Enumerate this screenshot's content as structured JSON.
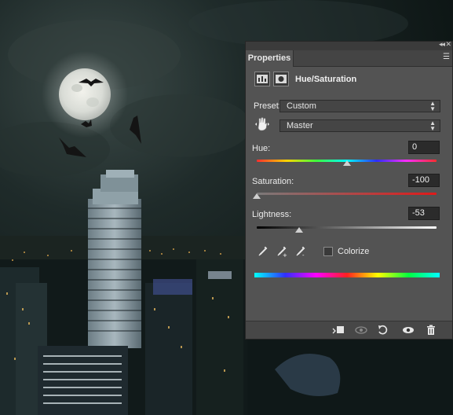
{
  "panel": {
    "tab_label": "Properties",
    "title": "Hue/Saturation",
    "preset_label": "Preset:",
    "preset_value": "Custom",
    "channel_value": "Master",
    "hue": {
      "label": "Hue:",
      "value": "0"
    },
    "saturation": {
      "label": "Saturation:",
      "value": "-100"
    },
    "lightness": {
      "label": "Lightness:",
      "value": "-53"
    },
    "colorize_label": "Colorize",
    "colorize_checked": false
  },
  "icons": {
    "header_adjustment": "hue-saturation-icon",
    "header_mask": "layer-mask-icon",
    "on_image_adjust": "hand-adjust-icon",
    "eyedroppers": [
      "eyedropper-icon",
      "eyedropper-plus-icon",
      "eyedropper-minus-icon"
    ],
    "bottom": [
      "clip-to-layer-icon",
      "view-previous-icon",
      "reset-icon",
      "visibility-eye-icon",
      "trash-icon"
    ]
  }
}
